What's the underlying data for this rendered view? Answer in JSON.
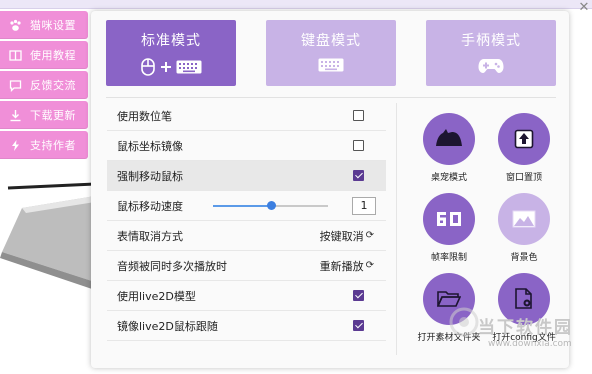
{
  "side_menu": [
    {
      "label": "猫咪设置",
      "icon": "paw-icon"
    },
    {
      "label": "使用教程",
      "icon": "book-icon"
    },
    {
      "label": "反馈交流",
      "icon": "chat-icon"
    },
    {
      "label": "下载更新",
      "icon": "download-icon"
    },
    {
      "label": "支持作者",
      "icon": "lightning-icon"
    }
  ],
  "modes": [
    {
      "label": "标准模式",
      "active": true,
      "icon": "mouse-plus-keyboard-icon"
    },
    {
      "label": "键盘模式",
      "active": false,
      "icon": "keyboard-icon"
    },
    {
      "label": "手柄模式",
      "active": false,
      "icon": "gamepad-icon"
    }
  ],
  "settings": [
    {
      "label": "使用数位笔",
      "type": "checkbox",
      "checked": false
    },
    {
      "label": "鼠标坐标镜像",
      "type": "checkbox",
      "checked": false
    },
    {
      "label": "强制移动鼠标",
      "type": "checkbox",
      "checked": true
    },
    {
      "label": "鼠标移动速度",
      "type": "slider",
      "value": "1",
      "level": 0.5
    },
    {
      "label": "表情取消方式",
      "type": "action",
      "value": "按键取消"
    },
    {
      "label": "音频被同时多次播放时",
      "type": "action",
      "value": "重新播放"
    },
    {
      "label": "使用live2D模型",
      "type": "checkbox",
      "checked": true
    },
    {
      "label": "镜像live2D鼠标跟随",
      "type": "checkbox",
      "checked": true
    }
  ],
  "tools": [
    {
      "label": "桌宠模式",
      "icon": "mountain-silhouette-icon",
      "style": "dark"
    },
    {
      "label": "窗口置顶",
      "icon": "pin-top-icon",
      "style": "dark"
    },
    {
      "label": "帧率限制",
      "icon": "fps-60-icon",
      "style": "dark"
    },
    {
      "label": "背景色",
      "icon": "image-icon",
      "style": "light"
    },
    {
      "label": "打开素材文件夹",
      "icon": "folder-open-icon",
      "style": "dark"
    },
    {
      "label": "打开config文件",
      "icon": "file-gear-icon",
      "style": "dark"
    }
  ],
  "watermark": {
    "brand": "当下软件园",
    "url": "www.downxia.com"
  },
  "colors": {
    "accent": "#8a64c6",
    "accent_light": "#c8b3e6",
    "menu_pink": "#f08fd8",
    "check": "#5b3a92"
  }
}
